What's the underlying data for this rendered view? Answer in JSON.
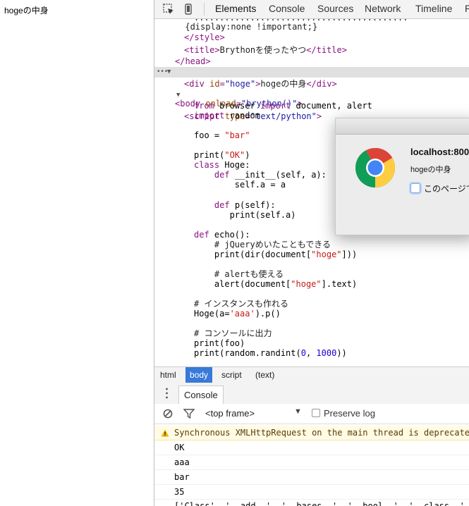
{
  "page": {
    "content": "hogeの中身"
  },
  "toolbar": {
    "tabs": [
      "Elements",
      "Console",
      "Sources",
      "Network",
      "Timeline",
      "P"
    ],
    "active_tab": "Elements"
  },
  "code": {
    "l0": "      {display:none !important;}",
    "l1_close_style": "</style>",
    "l2_title_open": "<title>",
    "l2_title_text": "Brythonを使ったやつ",
    "l2_title_close": "</title>",
    "l3_head_close": "</head>",
    "l4_body_open": "<body",
    "l4_attr": "onload",
    "l4_val": "\"brython()\"",
    "l4_end": ">",
    "l5_div_open": "<div",
    "l5_attr": "id",
    "l5_val": "\"hoge\"",
    "l5_text": "hogeの中身",
    "l5_div_close": "</div>",
    "l6_script_open": "<script",
    "l6_attr": "type",
    "l6_val": "\"text/python\"",
    "l6_end": ">",
    "py": [
      "from browser import document, alert",
      "import random",
      "",
      "foo = \"bar\"",
      "",
      "print(\"OK\")",
      "class Hoge:",
      "    def __init__(self, a):",
      "        self.a = a",
      "",
      "    def p(self):",
      "       print(self.a)",
      "",
      "def echo():",
      "    # jQueryめいたこともできる",
      "    print(dir(document[\"hoge\"]))",
      "",
      "    # alertも使える",
      "    alert(document[\"hoge\"].text)",
      "",
      "# インスタンスも作れる",
      "Hoge(a='aaa').p()",
      "",
      "# コンソールに出力",
      "print(foo)",
      "print(random.randint(0, 1000))"
    ]
  },
  "breadcrumbs": [
    "html",
    "body",
    "script",
    "(text)"
  ],
  "drawer": {
    "tab_label": "Console"
  },
  "console": {
    "frame_select": "<top frame>",
    "preserve_log_label": "Preserve log",
    "messages": [
      "Synchronous XMLHttpRequest on the main thread is deprecate",
      "OK",
      "aaa",
      "bar",
      "35",
      "['Class', '__add__', '__bases__', '__bool__', '__class__',"
    ]
  },
  "dialog": {
    "title": "localhost:800",
    "message": "hogeの中身",
    "checkbox_label": "このページで"
  },
  "colors": {
    "selected_crumb": "#3879d9",
    "warning_bg": "#fffbe5"
  }
}
